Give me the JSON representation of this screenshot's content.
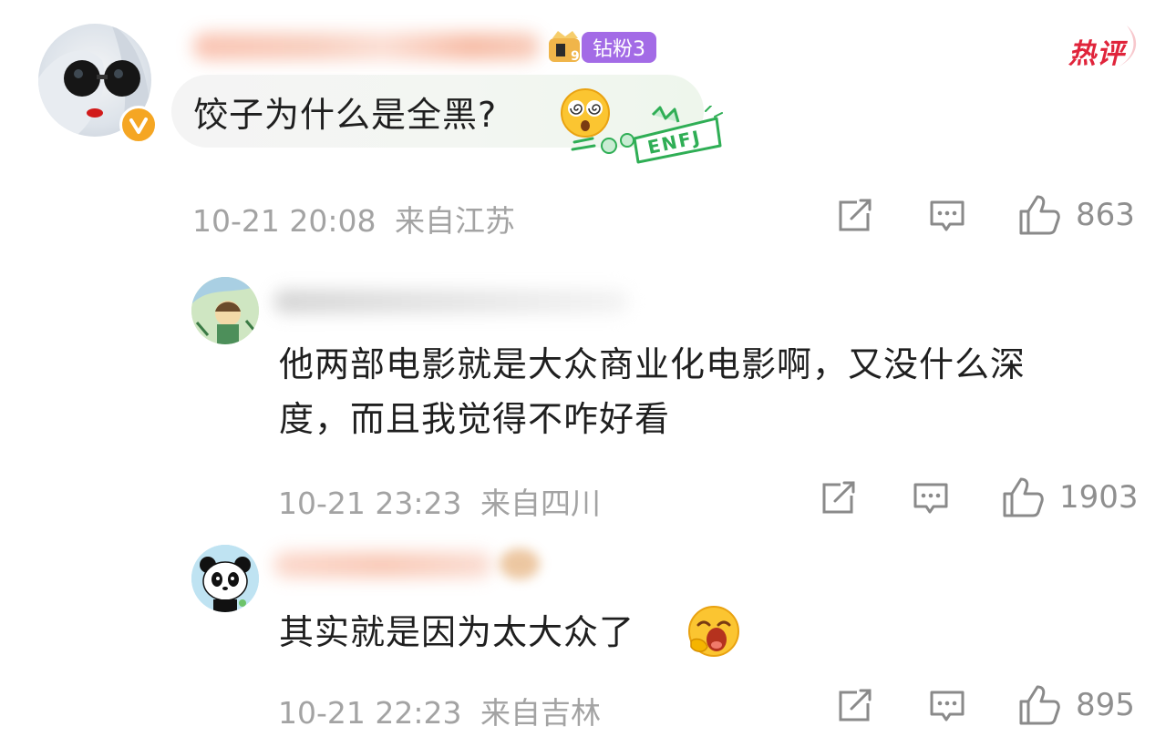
{
  "hot_label": "热评",
  "comment": {
    "badge_label": "钻粉3",
    "mbti_label": "ENFJ",
    "text": "饺子为什么是全黑?",
    "emoji": "dizzy-face-emoji",
    "time": "10-21 20:08",
    "location": "来自江苏",
    "likes": "863"
  },
  "replies": [
    {
      "text_line1": "他两部电影就是大众商业化电影啊，又没什么深",
      "text_line2": "度，而且我觉得不咋好看",
      "time": "10-21 23:23",
      "location": "来自四川",
      "likes": "1903"
    },
    {
      "text": "其实就是因为太大众了",
      "emoji": "yawning-face-emoji",
      "time": "10-21 22:23",
      "location": "来自吉林",
      "likes": "895"
    }
  ],
  "icons": [
    "share-icon",
    "comment-icon",
    "like-icon",
    "verified-icon",
    "fan-badge-icon"
  ],
  "colors": {
    "hot": "#e0243b",
    "badge": "#9b5fe0",
    "verified": "#f5a623",
    "mbti": "#2fae55",
    "meta": "#a3a3a3"
  }
}
